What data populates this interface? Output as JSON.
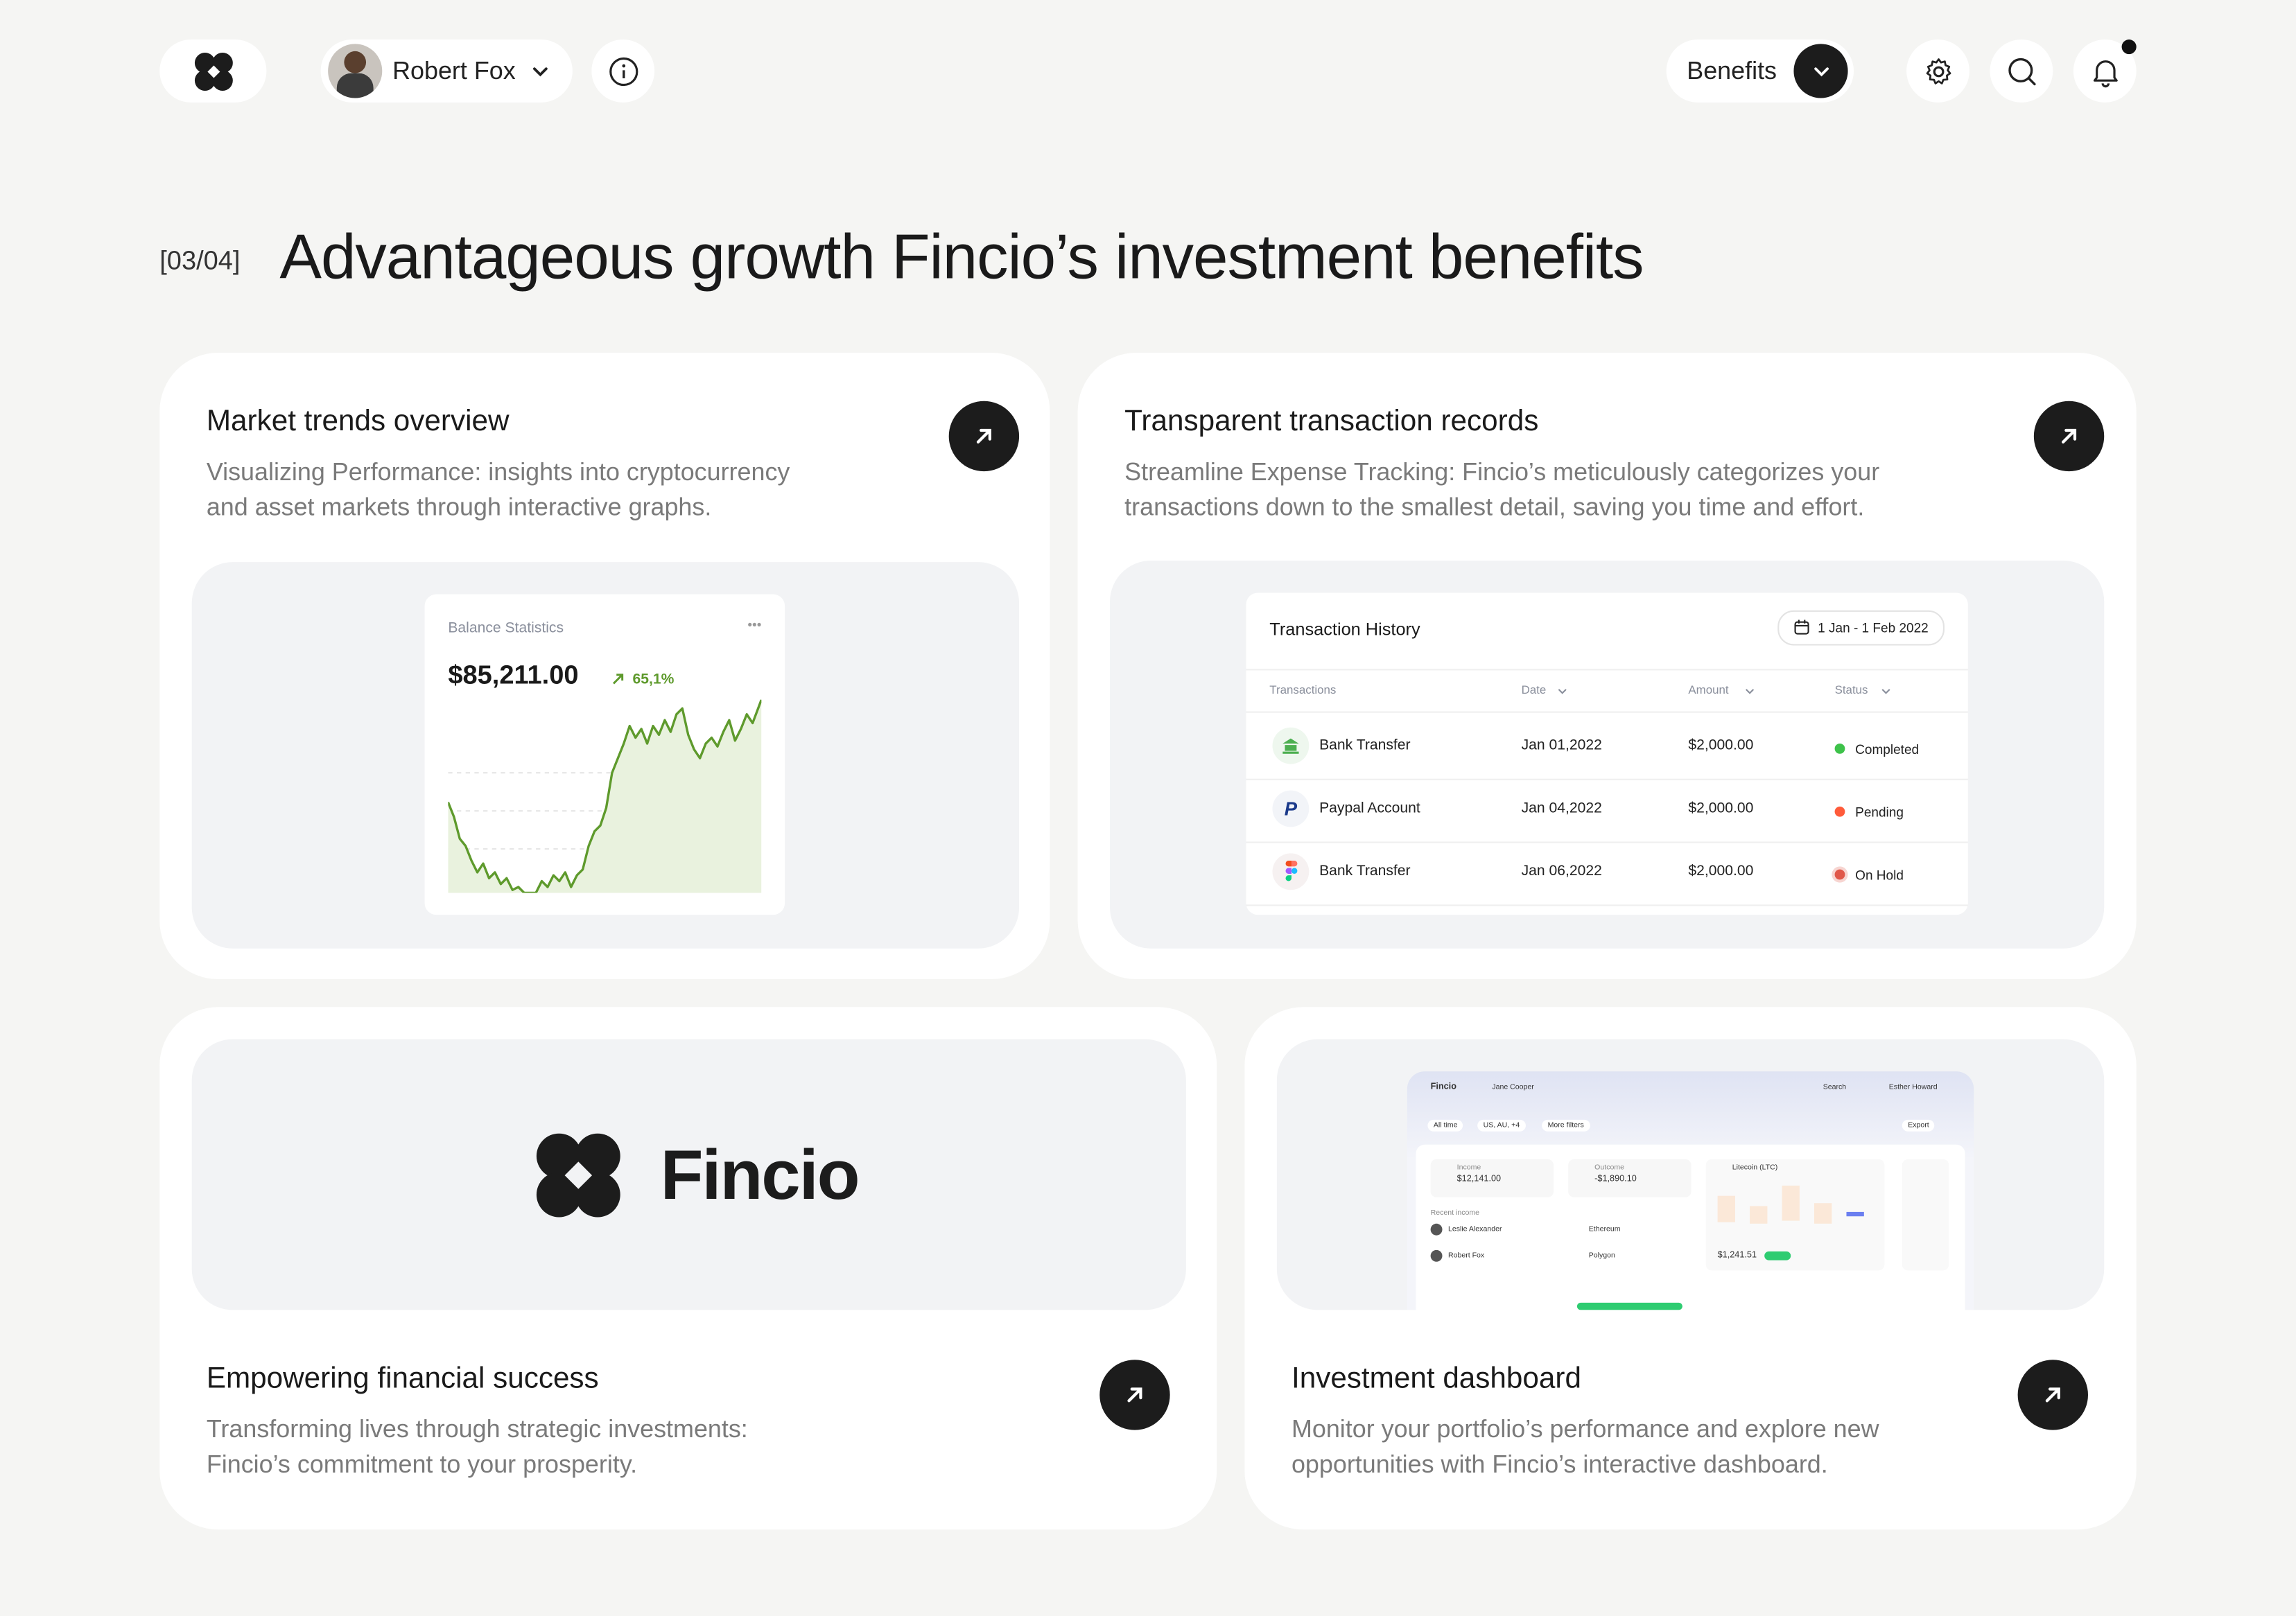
{
  "header": {
    "user_name": "Robert Fox",
    "menu_label": "Benefits"
  },
  "section": {
    "counter": "[03/04]",
    "title": "Advantageous growth Fincio’s investment benefits"
  },
  "cards": {
    "market": {
      "title": "Market trends overview",
      "desc_line1": "Visualizing Performance: insights into cryptocurrency",
      "desc_line2": "and asset markets through interactive graphs.",
      "widget": {
        "label": "Balance Statistics",
        "more": "•••",
        "amount": "$85,211.00",
        "change": "65,1%"
      }
    },
    "transactions": {
      "title": "Transparent transaction records",
      "desc_line1": "Streamline Expense Tracking: Fincio’s meticulously categorizes your",
      "desc_line2": "transactions down to the smallest detail, saving you time and effort.",
      "widget": {
        "title": "Transaction History",
        "date_range": "1 Jan - 1 Feb 2022",
        "columns": {
          "transactions": "Transactions",
          "date": "Date",
          "amount": "Amount",
          "status": "Status"
        },
        "rows": [
          {
            "name": "Bank Transfer",
            "date": "Jan 01,2022",
            "amount": "$2,000.00",
            "status": "Completed",
            "status_color": "#3ec24a"
          },
          {
            "name": "Paypal Account",
            "date": "Jan 04,2022",
            "amount": "$2,000.00",
            "status": "Pending",
            "status_color": "#ff5b3a"
          },
          {
            "name": "Bank Transfer",
            "date": "Jan 06,2022",
            "amount": "$2,000.00",
            "status": "On Hold",
            "status_color": "#e0584a"
          }
        ]
      }
    },
    "brand": {
      "logo_text": "Fincio",
      "title": "Empowering financial success",
      "desc_line1": "Transforming lives through strategic investments:",
      "desc_line2": "Fincio’s commitment to your prosperity."
    },
    "dashboard": {
      "title": "Investment dashboard",
      "desc_line1": "Monitor your portfolio’s performance and explore new",
      "desc_line2": "opportunities with Fincio’s interactive dashboard.",
      "preview": {
        "brand": "Fincio",
        "user": "Jane Cooper",
        "search": "Search",
        "account": "Esther Howard",
        "filter_all": "All time",
        "filter_region": "US, AU, +4",
        "filter_more": "More filters",
        "export": "Export",
        "income_label": "Income",
        "income_value": "$12,141.00",
        "outcome_label": "Outcome",
        "outcome_value": "-$1,890.10",
        "coin_label": "Litecoin (LTC)",
        "coin_value": "$1,241.51",
        "recent_income": "Recent income",
        "person1": "Leslie Alexander",
        "person2": "Robert Fox",
        "coin1": "Ethereum",
        "coin2": "Polygon"
      }
    }
  },
  "colors": {
    "background": "#f5f5f3",
    "dark": "#1c1c1c",
    "chart_line": "#5e9a2c",
    "chart_fill": "#e9f2de",
    "accent_green": "#5e9a2c"
  }
}
